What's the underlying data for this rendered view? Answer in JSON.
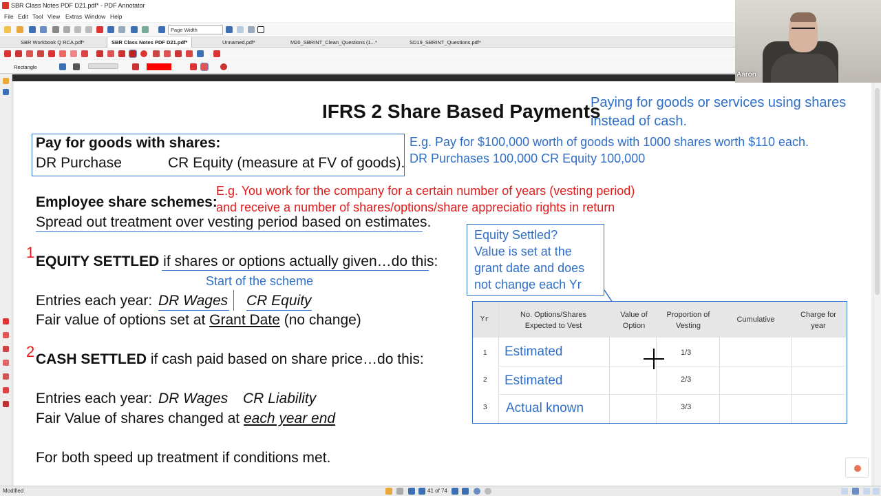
{
  "window": {
    "title": "SBR Class Notes PDF D21.pdf* - PDF Annotator"
  },
  "menu": [
    "File",
    "Edit",
    "Tool",
    "View",
    "Extras",
    "Window",
    "Help"
  ],
  "toolbar": {
    "zoom": "Page Width"
  },
  "tabs": [
    "SBR Workbook Q RCA.pdf*",
    "SBR Class Notes PDF D21.pdf*",
    "Unnamed.pdf*",
    "M20_SBRINT_Clean_Questions (1...*",
    "SD19_SBRINT_Questions.pdf*"
  ],
  "tool_label": "Rectangle",
  "colors": {
    "ink_blue": "#2f6fc7",
    "ink_red": "#e21a1a",
    "pen_swatch": "#ff0000"
  },
  "doc": {
    "title": "IFRS 2 Share Based Payments",
    "title_note": "Paying for goods or services using shares instead of cash.",
    "pay_heading": "Pay for goods with shares:",
    "pay_dr": "DR Purchase",
    "pay_cr": "CR Equity (measure at FV of goods).",
    "eg1_line1": "E.g. Pay for $100,000 worth of goods with 1000 shares worth $110 each.",
    "eg1_line2": "DR Purchases 100,000 CR Equity 100,000",
    "emp_heading": "Employee share schemes:",
    "emp_text": "Spread out treatment over vesting period based on estimates.",
    "eg2_line1": "E.g. You work for the company for a certain number of years (vesting period)",
    "eg2_line2": "and receive a number of shares/options/share appreciatio rights in return",
    "num1": "1",
    "eq_bold": "EQUITY SETTLED",
    "eq_rest": "if shares or options actually given…do this:",
    "start_note": "Start of the scheme",
    "eq_entries_label": "Entries each year:",
    "eq_dr": "DR Wages",
    "eq_cr": "CR Equity",
    "fv_options_pre": "Fair value of options set at",
    "fv_options_u": "Grant Date",
    "fv_options_post": "(no change)",
    "num2": "2",
    "cash_bold": "CASH SETTLED",
    "cash_rest": "if cash paid based on share price…do this:",
    "cash_entries_label": "Entries each year:",
    "cash_dr": "DR Wages",
    "cash_cr": "CR Liability",
    "fv_shares_pre": "Fair Value of shares changed at",
    "fv_shares_u": "each year end",
    "both": "For both speed up treatment if conditions met.",
    "callout": [
      "Equity Settled?",
      "Value is set at the",
      "grant date and does",
      "not change each Yr"
    ],
    "table": {
      "headers": [
        "Yr",
        "No. Options/Shares Expected to Vest",
        "Value of Option",
        "Proportion of Vesting",
        "Cumulative",
        "Charge for year"
      ],
      "rows": [
        {
          "yr": "1",
          "expected": "Estimated",
          "value": "",
          "proportion": "1/3",
          "cumulative": "",
          "charge": ""
        },
        {
          "yr": "2",
          "expected": "Estimated",
          "value": "",
          "proportion": "2/3",
          "cumulative": "",
          "charge": ""
        },
        {
          "yr": "3",
          "expected": "Actual known",
          "value": "",
          "proportion": "3/3",
          "cumulative": "",
          "charge": ""
        }
      ]
    }
  },
  "status": {
    "left": "Modified",
    "page": "41 of 74"
  },
  "webcam": {
    "name": "Aaron"
  }
}
